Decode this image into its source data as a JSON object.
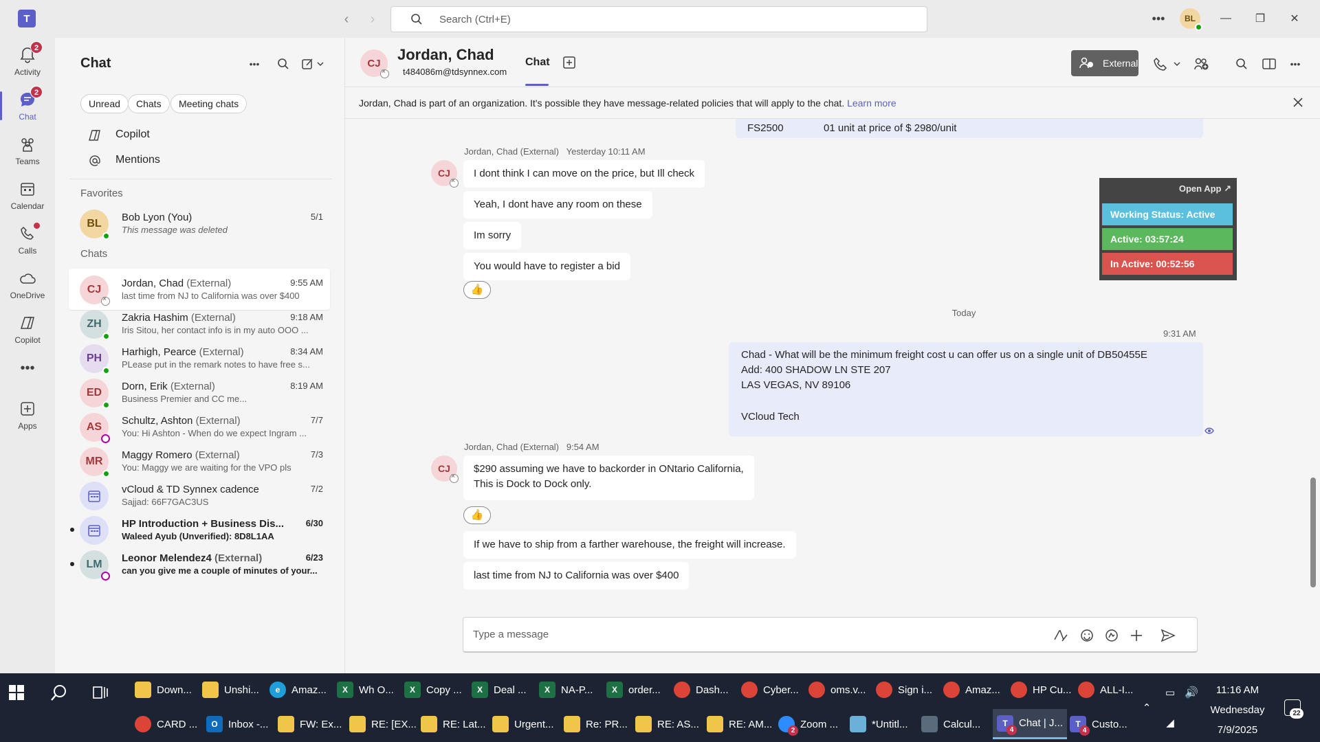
{
  "app": {
    "logo": "T"
  },
  "search": {
    "placeholder": "Search (Ctrl+E)"
  },
  "user": {
    "initials": "BL"
  },
  "rail": [
    {
      "label": "Activity",
      "badge": "2",
      "icon": "bell-icon"
    },
    {
      "label": "Chat",
      "badge": "2",
      "icon": "chat-icon"
    },
    {
      "label": "Teams",
      "icon": "teams-icon"
    },
    {
      "label": "Calendar",
      "icon": "calendar-icon"
    },
    {
      "label": "Calls",
      "icon": "phone-icon"
    },
    {
      "label": "OneDrive",
      "icon": "cloud-icon"
    },
    {
      "label": "Copilot",
      "icon": "copilot-icon"
    },
    {
      "label": "Apps",
      "icon": "apps-icon"
    }
  ],
  "chatlist": {
    "title": "Chat",
    "filters": [
      "Unread",
      "Chats",
      "Meeting chats"
    ],
    "links": [
      "Copilot",
      "Mentions"
    ],
    "favorites_label": "Favorites",
    "favorites": [
      {
        "initials": "BL",
        "name": "Bob Lyon (You)",
        "time": "5/1",
        "preview": "This message was deleted"
      }
    ],
    "chats_label": "Chats",
    "chats": [
      {
        "initials": "CJ",
        "name": "Jordan, Chad",
        "ext": "(External)",
        "time": "9:55 AM",
        "preview": "last time from NJ to California was over $400"
      },
      {
        "initials": "ZH",
        "name": "Zakria Hashim",
        "ext": "(External)",
        "time": "9:18 AM",
        "preview": "Iris Sitou, her contact info is in my auto OOO ..."
      },
      {
        "initials": "PH",
        "name": "Harhigh, Pearce",
        "ext": "(External)",
        "time": "8:34 AM",
        "preview": "PLease put in the remark notes to have free s..."
      },
      {
        "initials": "ED",
        "name": "Dorn, Erik",
        "ext": "(External)",
        "time": "8:19 AM",
        "preview": "Business Premier and CC me..."
      },
      {
        "initials": "AS",
        "name": "Schultz, Ashton",
        "ext": "(External)",
        "time": "7/7",
        "preview": "You: Hi Ashton -  When do we expect Ingram ..."
      },
      {
        "initials": "MR",
        "name": "Maggy Romero",
        "ext": "(External)",
        "time": "7/3",
        "preview": "You: Maggy we are waiting for the VPO pls"
      },
      {
        "initials": "",
        "name": "vCloud & TD Synnex cadence",
        "ext": "",
        "time": "7/2",
        "preview": "Sajjad: 66F7GAC3US"
      },
      {
        "initials": "",
        "name": "HP Introduction + Business Dis...",
        "ext": "",
        "time": "6/30",
        "preview": "Waleed Ayub (Unverified): 8D8L1AA"
      },
      {
        "initials": "LM",
        "name": "Leonor Melendez4",
        "ext": "(External)",
        "time": "6/23",
        "preview": "can you give me a couple of minutes of your..."
      }
    ]
  },
  "header": {
    "initials": "CJ",
    "name": "Jordan, Chad",
    "email": "t484086m@tdsynnex.com",
    "tab": "Chat",
    "external_label": "External"
  },
  "banner": {
    "text": "Jordan, Chad is part of an organization. It's possible they have message-related policies that will apply to the chat.",
    "link": "Learn more"
  },
  "messages": {
    "prev_fragment": {
      "c1": "FS2500",
      "c2": "01 unit at price of $ 2980/unit"
    },
    "group1_meta": "Jordan, Chad (External)   Yesterday 10:11 AM",
    "group1": [
      "I dont think I can move on the price, but Ill check",
      "Yeah, I dont have any room on these",
      "Im sorry",
      "You would have to register a bid"
    ],
    "reaction": "👍",
    "divider": "Today",
    "my_time": "9:31 AM",
    "my_lines": [
      "Chad -  What will be the minimum freight cost u can offer us on a single unit of DB50455E",
      "Add: 400 SHADOW LN STE 207",
      "LAS VEGAS, NV 89106",
      "",
      "VCloud Tech"
    ],
    "group2_meta": "Jordan, Chad (External)   9:54 AM",
    "group2_first": [
      "$290 assuming we have to backorder in ONtario California,",
      "This is Dock to Dock only."
    ],
    "group2": [
      "If we have to ship from a farther warehouse, the freight will increase.",
      "last time from NJ to California was over $400"
    ]
  },
  "widget": {
    "open": "Open App ↗",
    "status": "Working Status: Active",
    "active": "Active: 03:57:24",
    "inactive": "In Active: 00:52:56",
    "colors": {
      "status": "#5bc0de",
      "active": "#5cb85c",
      "inactive": "#d9534f"
    }
  },
  "compose": {
    "placeholder": "Type a message"
  },
  "taskbar": {
    "row1": [
      "Down...",
      "Unshi...",
      "Amaz...",
      "Wh O...",
      "Copy ...",
      "Deal ...",
      "NA-P...",
      "order...",
      "Dash...",
      "Cyber...",
      "oms.v...",
      "Sign i...",
      "Amaz...",
      "HP Cu...",
      "ALL-I..."
    ],
    "row2": [
      "CARD ...",
      "Inbox -...",
      "FW: Ex...",
      "RE: [EX...",
      "RE: Lat...",
      "Urgent...",
      "Re: PR...",
      "RE: AS...",
      "RE: AM...",
      "Zoom ...",
      "*Untitl...",
      "Calcul...",
      "Chat | J...",
      "Custo..."
    ],
    "badges": {
      "zoom": "2",
      "chat": "4",
      "custo": "4"
    },
    "time": "11:16 AM",
    "day": "Wednesday",
    "date": "7/9/2025",
    "notif": "22"
  }
}
